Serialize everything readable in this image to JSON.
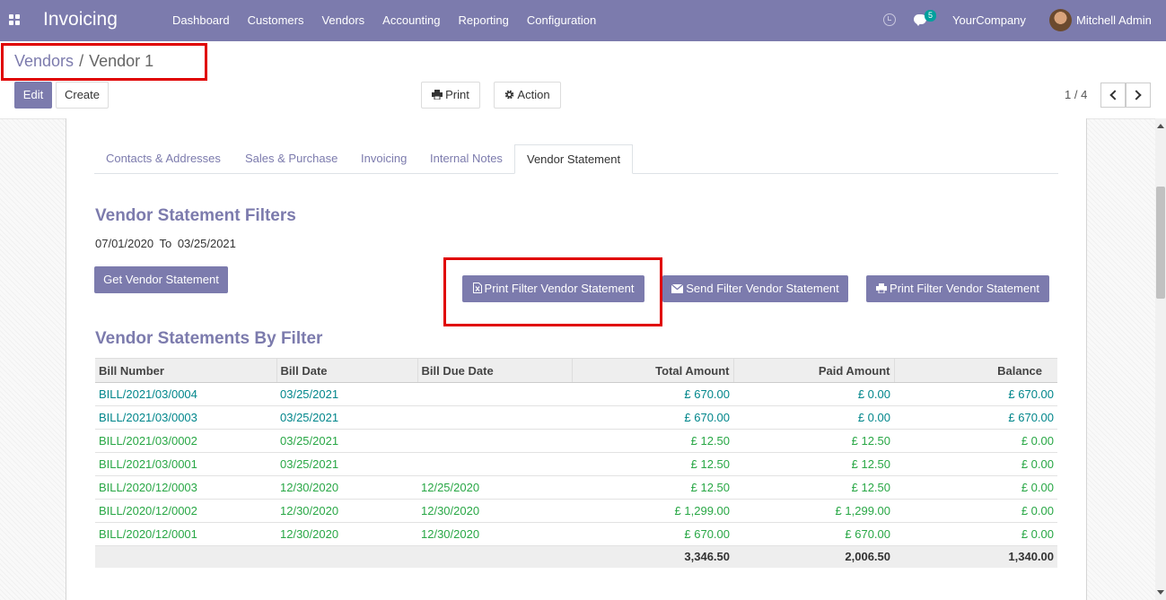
{
  "navbar": {
    "app_title": "Invoicing",
    "menu": [
      "Dashboard",
      "Customers",
      "Vendors",
      "Accounting",
      "Reporting",
      "Configuration"
    ],
    "chat_count": "5",
    "company": "YourCompany",
    "user": "Mitchell Admin",
    "color": "#7c7bad"
  },
  "breadcrumb": {
    "parent": "Vendors",
    "separator": "/",
    "current": "Vendor 1"
  },
  "toolbar": {
    "edit_label": "Edit",
    "create_label": "Create",
    "print_label": "Print",
    "action_label": "Action",
    "pager": "1 / 4"
  },
  "tabs": [
    "Contacts & Addresses",
    "Sales & Purchase",
    "Invoicing",
    "Internal Notes",
    "Vendor Statement"
  ],
  "active_tab": "Vendor Statement",
  "filters": {
    "title": "Vendor Statement Filters",
    "date_from": "07/01/2020",
    "to_label": "To",
    "date_to": "03/25/2021",
    "get_button": "Get Vendor Statement",
    "print_xls_button": "Print Filter Vendor Statement",
    "send_button": "Send Filter Vendor Statement",
    "print_pdf_button": "Print Filter Vendor Statement"
  },
  "statements": {
    "title": "Vendor Statements By Filter",
    "columns": [
      "Bill Number",
      "Bill Date",
      "Bill Due Date",
      "Total Amount",
      "Paid Amount",
      "Balance"
    ],
    "rows": [
      {
        "bill": "BILL/2021/03/0004",
        "date": "03/25/2021",
        "due": "",
        "total": "£ 670.00",
        "paid": "£ 0.00",
        "balance": "£ 670.00",
        "status": "blue"
      },
      {
        "bill": "BILL/2021/03/0003",
        "date": "03/25/2021",
        "due": "",
        "total": "£ 670.00",
        "paid": "£ 0.00",
        "balance": "£ 670.00",
        "status": "blue"
      },
      {
        "bill": "BILL/2021/03/0002",
        "date": "03/25/2021",
        "due": "",
        "total": "£ 12.50",
        "paid": "£ 12.50",
        "balance": "£ 0.00",
        "status": "green"
      },
      {
        "bill": "BILL/2021/03/0001",
        "date": "03/25/2021",
        "due": "",
        "total": "£ 12.50",
        "paid": "£ 12.50",
        "balance": "£ 0.00",
        "status": "green"
      },
      {
        "bill": "BILL/2020/12/0003",
        "date": "12/30/2020",
        "due": "12/25/2020",
        "total": "£ 12.50",
        "paid": "£ 12.50",
        "balance": "£ 0.00",
        "status": "green"
      },
      {
        "bill": "BILL/2020/12/0002",
        "date": "12/30/2020",
        "due": "12/30/2020",
        "total": "£ 1,299.00",
        "paid": "£ 1,299.00",
        "balance": "£ 0.00",
        "status": "green"
      },
      {
        "bill": "BILL/2020/12/0001",
        "date": "12/30/2020",
        "due": "12/30/2020",
        "total": "£ 670.00",
        "paid": "£ 670.00",
        "balance": "£ 0.00",
        "status": "green"
      }
    ],
    "totals": {
      "total": "3,346.50",
      "paid": "2,006.50",
      "balance": "1,340.00"
    }
  }
}
